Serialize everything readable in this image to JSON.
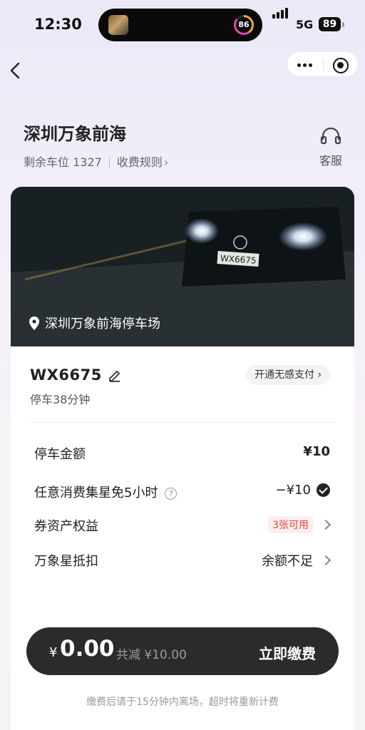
{
  "status_bar": {
    "time": "12:30",
    "activity_value": "86",
    "network": "5G",
    "battery": "89"
  },
  "nav": {
    "back_icon": "chevron-left-icon",
    "more_icon": "more-dots-icon",
    "close_icon": "target-circle-icon"
  },
  "header": {
    "title": "深圳万象前海",
    "spaces_label": "剩余车位 1327",
    "rules_label": "收费规则",
    "service_icon": "headset-icon",
    "service_label": "客服"
  },
  "photo": {
    "location_icon": "location-pin-icon",
    "location": "深圳万象前海停车场",
    "plate_in_photo": "WX6675"
  },
  "vehicle": {
    "plate": "WX6675",
    "edit_icon": "pencil-icon",
    "duration": "停车38分钟",
    "seamless_pay": "开通无感支付"
  },
  "fees": {
    "parking_label": "停车金额",
    "parking_value": "¥10",
    "discount_label": "任意消费集星免5小时",
    "discount_value": "−¥10",
    "coupon_label": "券资产权益",
    "coupon_badge": "3张可用",
    "points_label": "万象星抵扣",
    "points_value": "余额不足"
  },
  "pay_bar": {
    "currency": "¥",
    "amount": "0.00",
    "saved": "共减 ¥10.00",
    "button": "立即缴费"
  },
  "footer_note": "缴费后请于15分钟内离场，超时将重新计费",
  "colors": {
    "accent_red": "#e0483f",
    "pay_bar_bg": "#2b2b2b"
  }
}
